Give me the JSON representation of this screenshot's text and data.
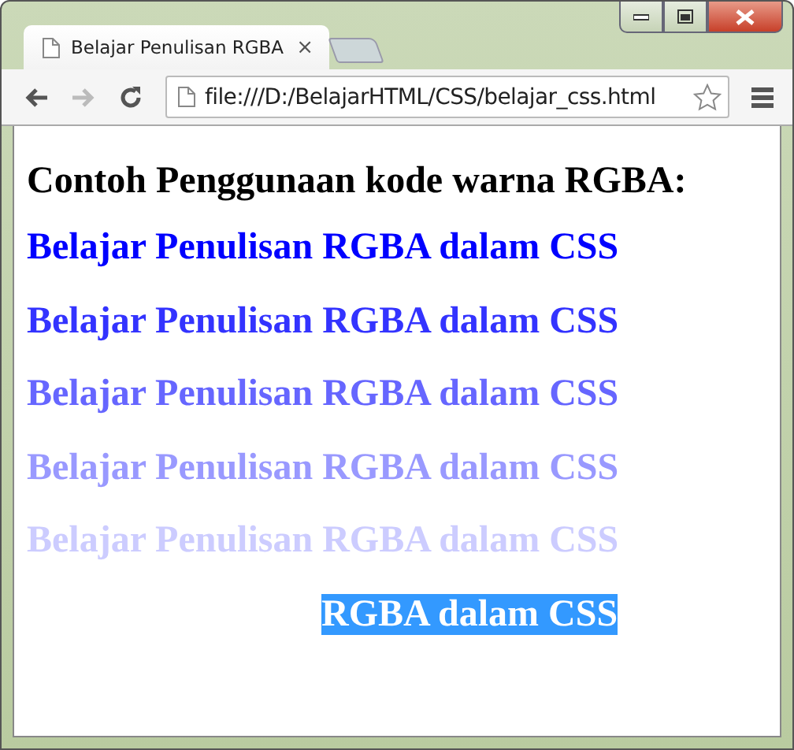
{
  "tab": {
    "title": "Belajar Penulisan RGBA",
    "close": "×"
  },
  "address_bar": {
    "value": "file:///D:/BelajarHTML/CSS/belajar_css.html"
  },
  "page": {
    "heading": "Contoh Penggunaan kode warna RGBA:",
    "lines": [
      {
        "kind": "text",
        "text": "Belajar Penulisan RGBA dalam CSS",
        "color": "#0000ff"
      },
      {
        "kind": "text",
        "text": "Belajar Penulisan RGBA dalam CSS",
        "color": "#3333ff"
      },
      {
        "kind": "text",
        "text": "Belajar Penulisan RGBA dalam CSS",
        "color": "#6666ff"
      },
      {
        "kind": "text",
        "text": "Belajar Penulisan RGBA dalam CSS",
        "color": "#9999ff"
      },
      {
        "kind": "text",
        "text": "Belajar Penulisan RGBA dalam CSS",
        "color": "#ccccff"
      },
      {
        "kind": "highlight",
        "text": "RGBA dalam CSS",
        "color": "#3399ff"
      }
    ]
  }
}
